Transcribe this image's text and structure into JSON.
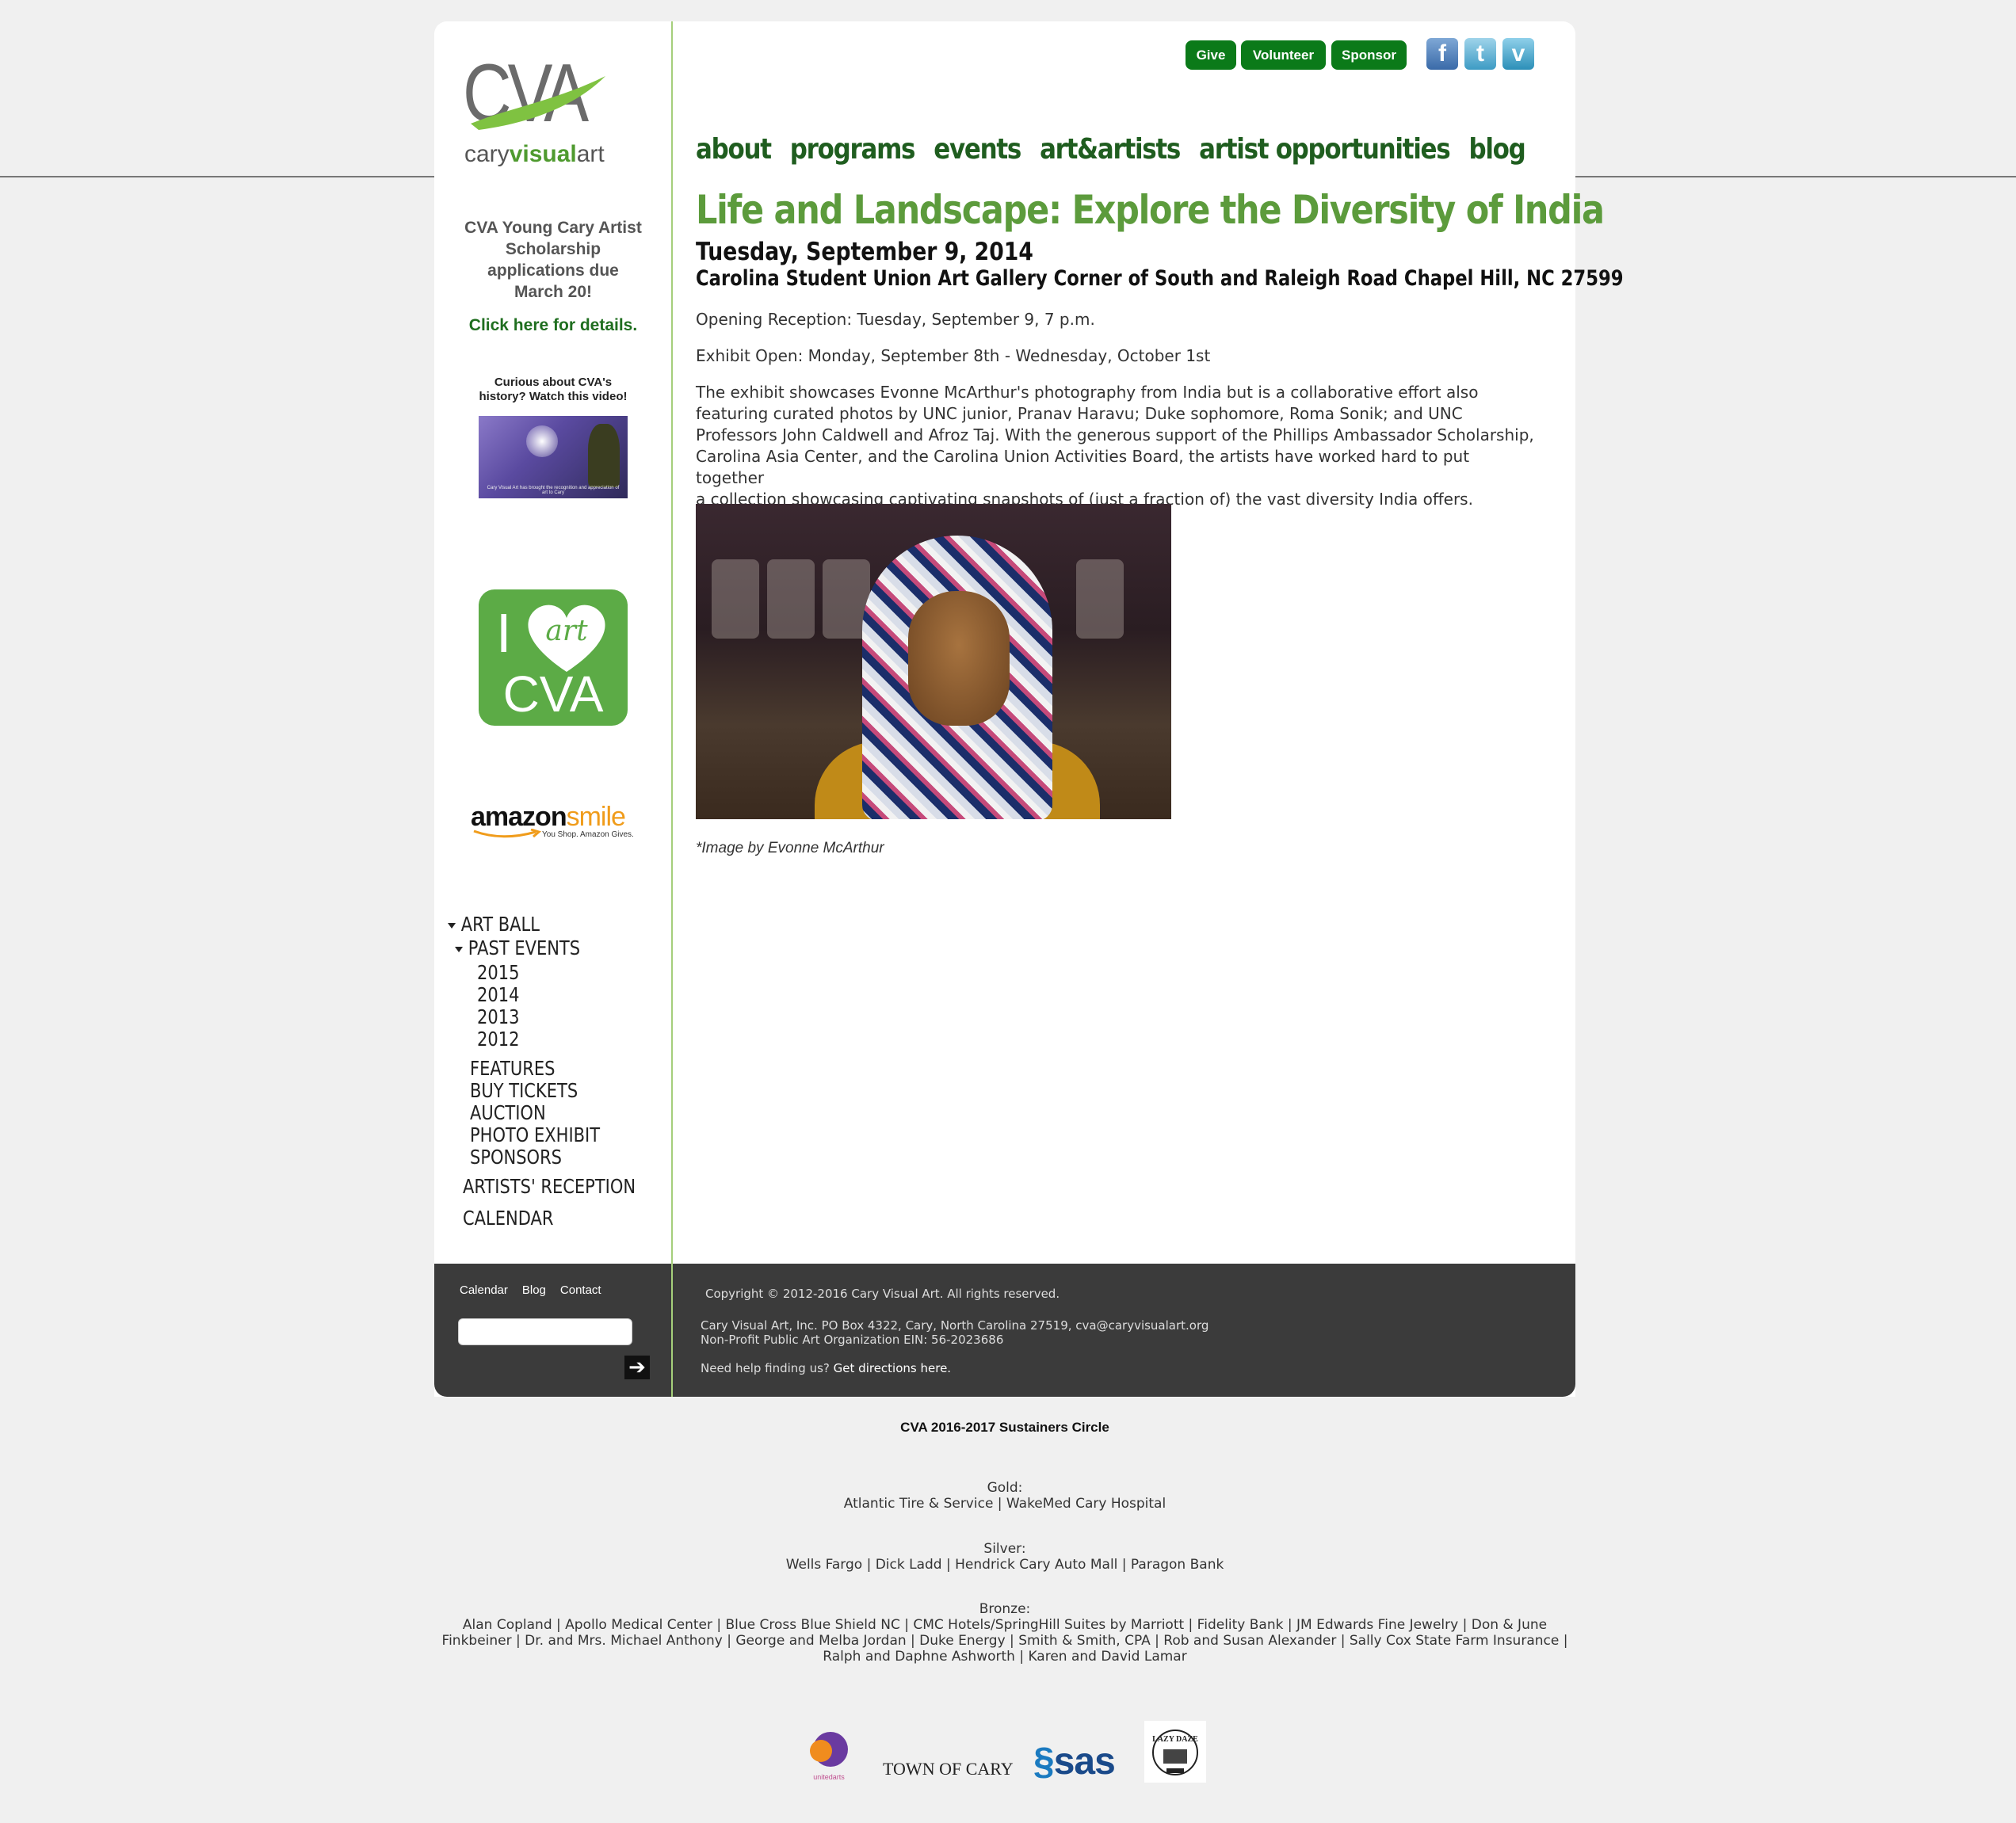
{
  "header": {
    "logo_text": "CVA",
    "logo_sub_plain": "cary",
    "logo_sub_bold": "visual",
    "logo_sub_end": "art",
    "buttons": [
      "Give",
      "Volunteer",
      "Sponsor"
    ],
    "social": [
      {
        "icon": "facebook-icon",
        "glyph": "f"
      },
      {
        "icon": "twitter-icon",
        "glyph": "t"
      },
      {
        "icon": "vimeo-icon",
        "glyph": "v"
      }
    ]
  },
  "nav": [
    "about",
    "programs",
    "events",
    "art&artists",
    "artist opportunities",
    "blog"
  ],
  "sidebar": {
    "promo_lines": [
      "CVA Young Cary Artist",
      "Scholarship",
      "applications due",
      "March 20!"
    ],
    "promo_link": "Click here for details.",
    "video_caption_lines": [
      "Curious about CVA's",
      "history? Watch this video!"
    ],
    "video_overlay": "Cary Visual Art has brought the recognition and appreciation of art to Cary",
    "iheart": {
      "i": "I",
      "heart_word": "art",
      "cva": "CVA"
    },
    "amazon": {
      "word1": "amazon",
      "word2": "smile",
      "tagline": "You Shop. Amazon Gives."
    },
    "menu": {
      "art_ball": "ART BALL",
      "past_events": "PAST EVENTS",
      "years": [
        "2015",
        "2014",
        "2013",
        "2012"
      ],
      "items": [
        "FEATURES",
        "BUY TICKETS",
        "AUCTION",
        "PHOTO EXHIBIT",
        "SPONSORS"
      ],
      "artists_reception": "ARTISTS' RECEPTION",
      "calendar": "CALENDAR"
    }
  },
  "main": {
    "title": "Life and Landscape: Explore the Diversity of India",
    "date": "Tuesday, September 9, 2014",
    "venue": "Carolina Student Union Art Gallery Corner of South and Raleigh Road Chapel Hill, NC 27599",
    "reception": "Opening Reception: Tuesday, September 9, 7 p.m.",
    "exhibit": "Exhibit Open: Monday, September 8th - Wednesday, October 1st",
    "description_lines": [
      "The exhibit showcases Evonne McArthur's photography from India but is a collaborative effort also",
      "featuring curated photos by UNC junior, Pranav Haravu; Duke sophomore, Roma Sonik; and UNC",
      "Professors John Caldwell and Afroz Taj. With the generous support of the Phillips Ambassador Scholarship,",
      "Carolina Asia Center, and the Carolina Union Activities Board, the artists have worked hard to put together",
      "a collection showcasing captivating snapshots of (just a fraction of) the vast diversity India offers."
    ],
    "caption": "*Image by Evonne McArthur"
  },
  "footer": {
    "links": [
      "Calendar",
      "Blog",
      "Contact"
    ],
    "search_value": "",
    "go_glyph": "➔",
    "copyright": "Copyright © 2012-2016 Cary Visual Art. All rights reserved.",
    "address": "Cary Visual Art, Inc. PO Box 4322, Cary, North Carolina 27519, cva@caryvisualart.org",
    "ein": "Non-Profit Public Art Organization EIN: 56-2023686",
    "help_prefix": "Need help finding us?",
    "help_link": "Get directions here."
  },
  "sustainers": {
    "title": "CVA 2016-2017 Sustainers Circle",
    "gold_label": "Gold:",
    "gold": "Atlantic Tire & Service | WakeMed Cary Hospital",
    "silver_label": "Silver:",
    "silver": "Wells Fargo | Dick Ladd | Hendrick Cary Auto Mall | Paragon Bank",
    "bronze_label": "Bronze:",
    "bronze_lines": [
      "Alan Copland | Apollo Medical Center | Blue Cross Blue Shield NC | CMC Hotels/SpringHill Suites by Marriott | Fidelity Bank | JM Edwards Fine Jewelry | Don & June",
      "Finkbeiner | Dr. and Mrs. Michael Anthony | George and Melba Jordan | Duke Energy | Smith & Smith, CPA | Rob and Susan Alexander | Sally Cox State Farm Insurance |",
      "Ralph and Daphne Ashworth | Karen and David Lamar"
    ]
  },
  "partner_logos": {
    "united_arts": "unitedarts",
    "town_of_cary": "TOWN OF CARY",
    "sas": "sas",
    "lazy_daze": "LAZY DAZE"
  },
  "colors": {
    "accent_green": "#5c9b3c",
    "nav_green": "#1f5d1f",
    "button_green": "#0b7a19",
    "footer_bg": "#3b3b3b"
  }
}
